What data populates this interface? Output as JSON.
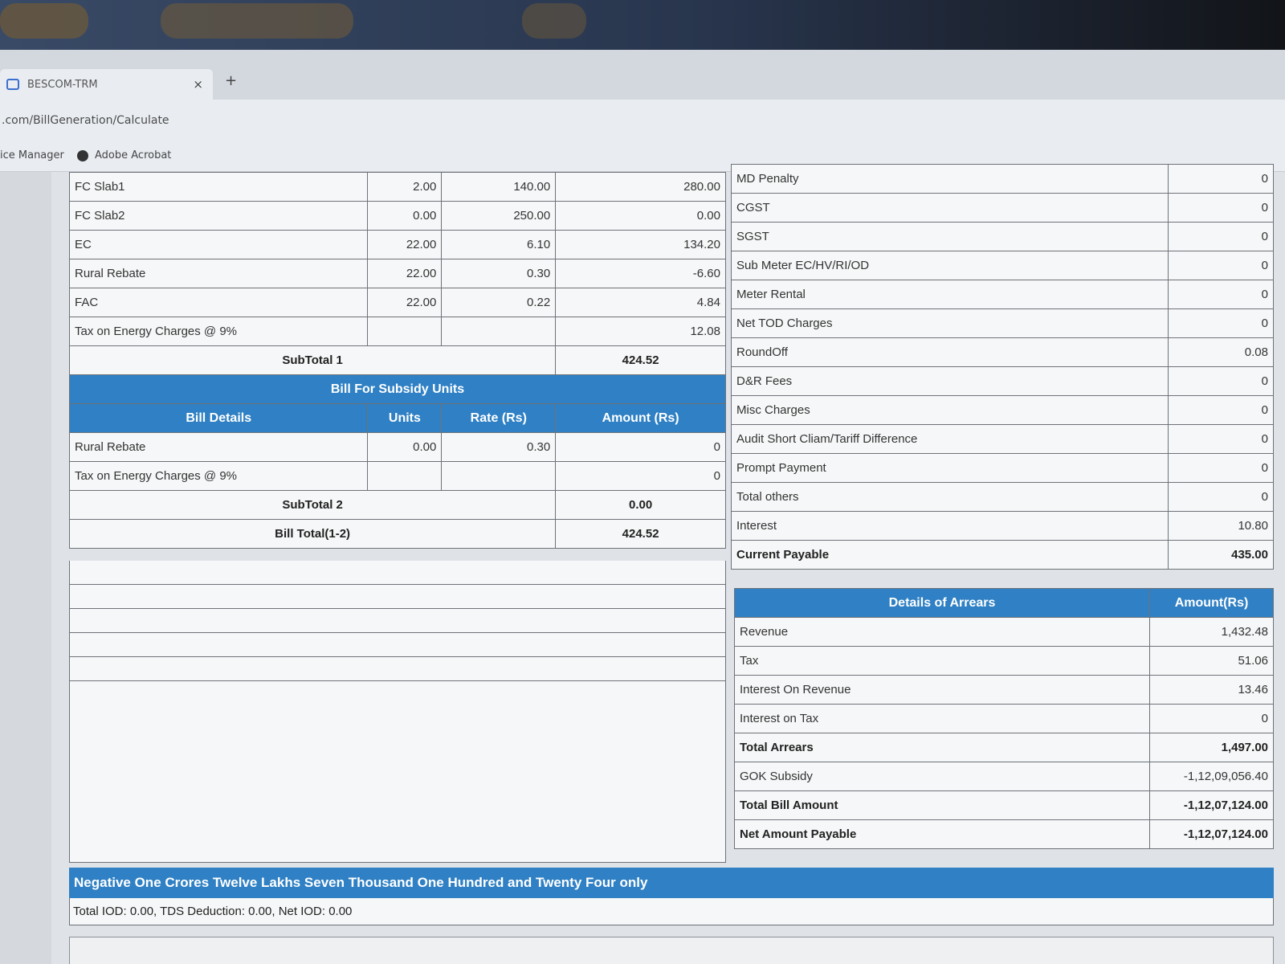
{
  "browser": {
    "tab_title": "BESCOM-TRM",
    "tab_close": "×",
    "new_tab": "+",
    "url": ".com/BillGeneration/Calculate",
    "bookmarks": [
      "ice Manager",
      "Adobe Acrobat"
    ]
  },
  "bill_rows": [
    {
      "label": "FC Slab1",
      "units": "2.00",
      "rate": "140.00",
      "amount": "280.00"
    },
    {
      "label": "FC Slab2",
      "units": "0.00",
      "rate": "250.00",
      "amount": "0.00"
    },
    {
      "label": "EC",
      "units": "22.00",
      "rate": "6.10",
      "amount": "134.20"
    },
    {
      "label": "Rural Rebate",
      "units": "22.00",
      "rate": "0.30",
      "amount": "-6.60"
    },
    {
      "label": "FAC",
      "units": "22.00",
      "rate": "0.22",
      "amount": "4.84"
    },
    {
      "label": "Tax on Energy Charges @ 9%",
      "units": "",
      "rate": "",
      "amount": "12.08"
    }
  ],
  "subtotal1": {
    "label": "SubTotal 1",
    "value": "424.52"
  },
  "subsidy": {
    "title": "Bill For Subsidy Units",
    "headers": {
      "details": "Bill Details",
      "units": "Units",
      "rate": "Rate (Rs)",
      "amount": "Amount (Rs)"
    },
    "rows": [
      {
        "label": "Rural Rebate",
        "units": "0.00",
        "rate": "0.30",
        "amount": "0"
      },
      {
        "label": "Tax on Energy Charges @ 9%",
        "units": "",
        "rate": "",
        "amount": "0"
      }
    ]
  },
  "subtotal2": {
    "label": "SubTotal 2",
    "value": "0.00"
  },
  "bill_total": {
    "label": "Bill Total(1-2)",
    "value": "424.52"
  },
  "others": [
    {
      "label": "MD Penalty",
      "value": "0"
    },
    {
      "label": "CGST",
      "value": "0"
    },
    {
      "label": "SGST",
      "value": "0"
    },
    {
      "label": "Sub Meter EC/HV/RI/OD",
      "value": "0"
    },
    {
      "label": "Meter Rental",
      "value": "0"
    },
    {
      "label": "Net TOD Charges",
      "value": "0"
    },
    {
      "label": "RoundOff",
      "value": "0.08"
    },
    {
      "label": "D&R Fees",
      "value": "0"
    },
    {
      "label": "Misc Charges",
      "value": "0"
    },
    {
      "label": "Audit Short Cliam/Tariff Difference",
      "value": "0"
    },
    {
      "label": "Prompt Payment",
      "value": "0"
    },
    {
      "label": "Total others",
      "value": "0"
    },
    {
      "label": "Interest",
      "value": "10.80"
    }
  ],
  "current_payable": {
    "label": "Current Payable",
    "value": "435.00"
  },
  "arrears": {
    "header": "Details of Arrears",
    "amount_header": "Amount(Rs)",
    "rows": [
      {
        "label": "Revenue",
        "value": "1,432.48"
      },
      {
        "label": "Tax",
        "value": "51.06"
      },
      {
        "label": "Interest On Revenue",
        "value": "13.46"
      },
      {
        "label": "Interest on Tax",
        "value": "0"
      }
    ]
  },
  "total_arrears": {
    "label": "Total Arrears",
    "value": "1,497.00"
  },
  "gok_subsidy": {
    "label": "GOK Subsidy",
    "value": "-1,12,09,056.40"
  },
  "total_bill_amount": {
    "label": "Total Bill Amount",
    "value": "-1,12,07,124.00"
  },
  "net_amount_payable": {
    "label": "Net Amount Payable",
    "value": "-1,12,07,124.00"
  },
  "amount_in_words": "Negative One Crores Twelve Lakhs Seven Thousand One Hundred and Twenty Four only",
  "iod_line": "Total IOD: 0.00, TDS Deduction: 0.00, Net IOD: 0.00"
}
